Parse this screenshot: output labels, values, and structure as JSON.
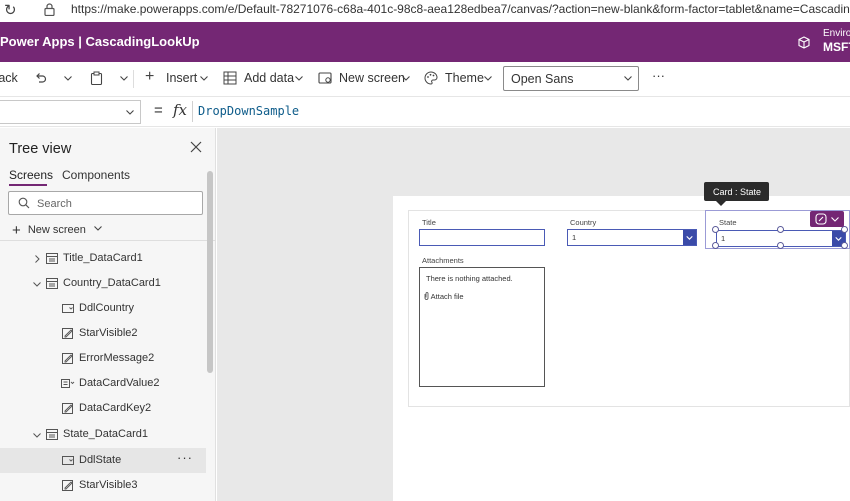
{
  "browser": {
    "url": "https://make.powerapps.com/e/Default-78271076-c68a-401c-98c8-aea128edbea7/canvas/?action=new-blank&form-factor=tablet&name=CascadingLookUp"
  },
  "app": {
    "title": "Power Apps  |  CascadingLookUp",
    "environment_label": "Enviro",
    "environment_name": "MSFT"
  },
  "commandbar": {
    "back": "Back",
    "insert": "Insert",
    "add_data": "Add data",
    "new_screen": "New screen",
    "theme": "Theme",
    "font_value": "Open Sans",
    "more": "···"
  },
  "formulabar": {
    "property": "",
    "equals": "=",
    "fx": "fx",
    "formula": "DropDownSample"
  },
  "tree": {
    "heading": "Tree view",
    "tabs": [
      "Screens",
      "Components"
    ],
    "search_placeholder": "Search",
    "new_screen": "New screen",
    "nodes": [
      {
        "label": "Title_DataCard1",
        "icon": "card-icon",
        "expand": "collapsed",
        "level": 1
      },
      {
        "label": "Country_DataCard1",
        "icon": "card-icon",
        "expand": "expanded",
        "level": 1
      },
      {
        "label": "DdlCountry",
        "icon": "dropdown-icon",
        "level": 2
      },
      {
        "label": "StarVisible2",
        "icon": "edit-icon",
        "level": 2
      },
      {
        "label": "ErrorMessage2",
        "icon": "edit-icon",
        "level": 2
      },
      {
        "label": "DataCardValue2",
        "icon": "combobox-icon",
        "level": 2
      },
      {
        "label": "DataCardKey2",
        "icon": "edit-icon",
        "level": 2
      },
      {
        "label": "State_DataCard1",
        "icon": "card-icon",
        "expand": "expanded",
        "level": 1
      },
      {
        "label": "DdlState",
        "icon": "dropdown-icon",
        "level": 2,
        "selected": true
      },
      {
        "label": "StarVisible3",
        "icon": "edit-icon",
        "level": 2
      }
    ],
    "more": "···"
  },
  "form": {
    "title_label": "Title",
    "country_label": "Country",
    "country_value": "1",
    "state_label": "State",
    "state_value": "1",
    "attachments_label": "Attachments",
    "attachments_empty": "There is nothing attached.",
    "attach_file": "Attach file",
    "tooltip": "Card : State"
  },
  "colors": {
    "brand": "#742774",
    "input_border": "#4a5ab5",
    "dropdown_button": "#3a4aa8"
  }
}
